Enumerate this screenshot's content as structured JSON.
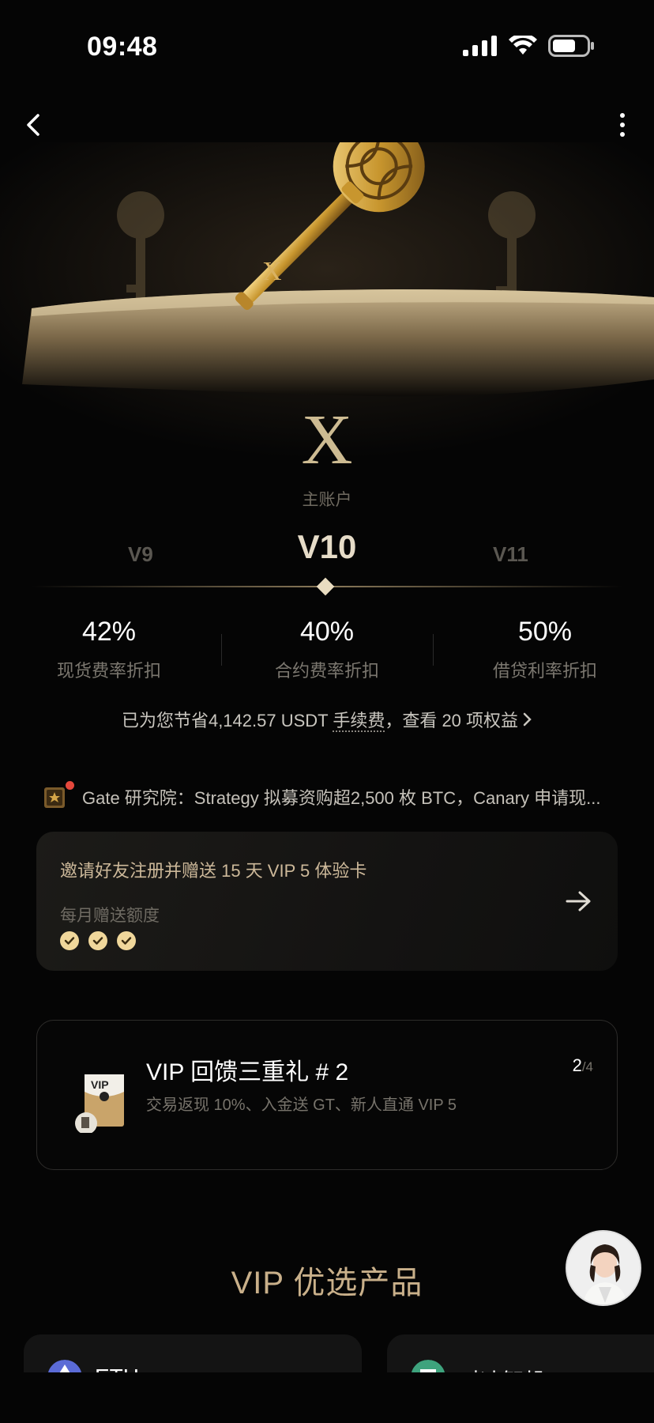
{
  "status_bar": {
    "time": "09:48"
  },
  "hero": {
    "tier_letter": "X",
    "account_label": "主账户"
  },
  "levels": {
    "previous": "V9",
    "current": "V10",
    "next": "V11"
  },
  "stats": [
    {
      "value": "42%",
      "label": "现货费率折扣"
    },
    {
      "value": "40%",
      "label": "合约费率折扣"
    },
    {
      "value": "50%",
      "label": "借贷利率折扣"
    }
  ],
  "savings": {
    "prefix": "已为您节省4,142.57 USDT ",
    "fee_link": "手续费",
    "suffix": "，查看 20 项权益"
  },
  "news": {
    "text": "Gate 研究院：Strategy 拟募资购超2,500 枚 BTC，Canary 申请现..."
  },
  "invite": {
    "title": "邀请好友注册并赠送 15 天 VIP 5 体验卡",
    "subtitle": "每月赠送额度",
    "checks_filled": 3
  },
  "vip_promo": {
    "title": "VIP 回馈三重礼 # 2",
    "description": "交易返现 10%、入金送 GT、新人直通 VIP 5",
    "page_current": "2",
    "page_total": "/4",
    "icon_text": "VIP"
  },
  "products_section": {
    "title": "VIP 优选产品"
  },
  "products": [
    {
      "name": "ETH"
    },
    {
      "name": "对冲智投-USDT"
    }
  ],
  "colors": {
    "gold": "#cdb99a",
    "background": "#050505",
    "check": "#f0d79b"
  }
}
